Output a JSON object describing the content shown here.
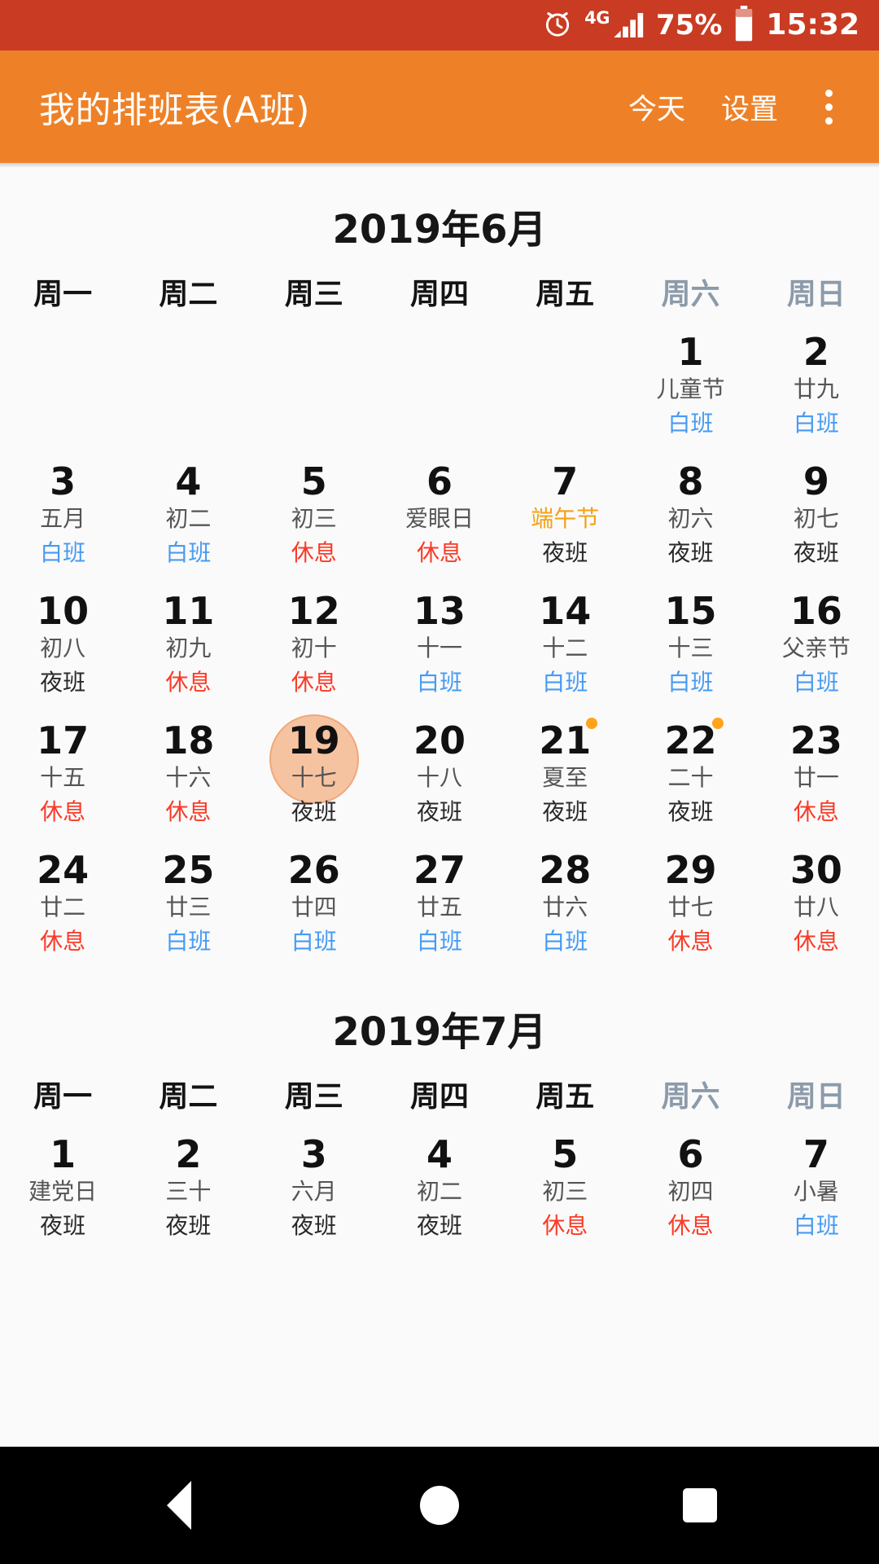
{
  "status_bar": {
    "alarm_icon": "alarm-clock-icon",
    "network_label": "4G",
    "signal_icon": "signal-bars-icon",
    "battery_percent": "75%",
    "battery_icon": "battery-icon",
    "clock": "15:32"
  },
  "toolbar": {
    "title": "我的排班表(A班)",
    "today_label": "今天",
    "settings_label": "设置",
    "overflow_icon": "overflow-menu-icon"
  },
  "colors": {
    "status_bar_bg": "#C93B22",
    "toolbar_bg": "#EE8127",
    "page_bg": "#FAFAFA",
    "weekend_header": "#8C9BAA",
    "shift_day": "#479BF3",
    "shift_night": "#282828",
    "shift_rest": "#F93B28",
    "festival_orange": "#F5A012",
    "today_circle": "#F6C3A0",
    "event_dot": "#FFA41B"
  },
  "weekdays": [
    {
      "label": "周一",
      "weekend": false
    },
    {
      "label": "周二",
      "weekend": false
    },
    {
      "label": "周三",
      "weekend": false
    },
    {
      "label": "周四",
      "weekend": false
    },
    {
      "label": "周五",
      "weekend": false
    },
    {
      "label": "周六",
      "weekend": true
    },
    {
      "label": "周日",
      "weekend": true
    }
  ],
  "months": [
    {
      "title": "2019年6月",
      "weeks": [
        [
          {
            "empty": true
          },
          {
            "empty": true
          },
          {
            "empty": true
          },
          {
            "empty": true
          },
          {
            "empty": true
          },
          {
            "day": "1",
            "lunar": "儿童节",
            "shift": "白班",
            "shift_type": "day"
          },
          {
            "day": "2",
            "lunar": "廿九",
            "shift": "白班",
            "shift_type": "day"
          }
        ],
        [
          {
            "day": "3",
            "lunar": "五月",
            "shift": "白班",
            "shift_type": "day"
          },
          {
            "day": "4",
            "lunar": "初二",
            "shift": "白班",
            "shift_type": "day"
          },
          {
            "day": "5",
            "lunar": "初三",
            "shift": "休息",
            "shift_type": "rest"
          },
          {
            "day": "6",
            "lunar": "爱眼日",
            "shift": "休息",
            "shift_type": "rest"
          },
          {
            "day": "7",
            "lunar": "端午节",
            "lunar_festival": true,
            "shift": "夜班",
            "shift_type": "night"
          },
          {
            "day": "8",
            "lunar": "初六",
            "shift": "夜班",
            "shift_type": "night"
          },
          {
            "day": "9",
            "lunar": "初七",
            "shift": "夜班",
            "shift_type": "night"
          }
        ],
        [
          {
            "day": "10",
            "lunar": "初八",
            "shift": "夜班",
            "shift_type": "night"
          },
          {
            "day": "11",
            "lunar": "初九",
            "shift": "休息",
            "shift_type": "rest"
          },
          {
            "day": "12",
            "lunar": "初十",
            "shift": "休息",
            "shift_type": "rest"
          },
          {
            "day": "13",
            "lunar": "十一",
            "shift": "白班",
            "shift_type": "day"
          },
          {
            "day": "14",
            "lunar": "十二",
            "shift": "白班",
            "shift_type": "day"
          },
          {
            "day": "15",
            "lunar": "十三",
            "shift": "白班",
            "shift_type": "day"
          },
          {
            "day": "16",
            "lunar": "父亲节",
            "shift": "白班",
            "shift_type": "day"
          }
        ],
        [
          {
            "day": "17",
            "lunar": "十五",
            "shift": "休息",
            "shift_type": "rest"
          },
          {
            "day": "18",
            "lunar": "十六",
            "shift": "休息",
            "shift_type": "rest"
          },
          {
            "day": "19",
            "lunar": "十七",
            "shift": "夜班",
            "shift_type": "night",
            "today": true
          },
          {
            "day": "20",
            "lunar": "十八",
            "shift": "夜班",
            "shift_type": "night"
          },
          {
            "day": "21",
            "lunar": "夏至",
            "shift": "夜班",
            "shift_type": "night",
            "dot": true
          },
          {
            "day": "22",
            "lunar": "二十",
            "shift": "夜班",
            "shift_type": "night",
            "dot": true
          },
          {
            "day": "23",
            "lunar": "廿一",
            "shift": "休息",
            "shift_type": "rest"
          }
        ],
        [
          {
            "day": "24",
            "lunar": "廿二",
            "shift": "休息",
            "shift_type": "rest"
          },
          {
            "day": "25",
            "lunar": "廿三",
            "shift": "白班",
            "shift_type": "day"
          },
          {
            "day": "26",
            "lunar": "廿四",
            "shift": "白班",
            "shift_type": "day"
          },
          {
            "day": "27",
            "lunar": "廿五",
            "shift": "白班",
            "shift_type": "day"
          },
          {
            "day": "28",
            "lunar": "廿六",
            "shift": "白班",
            "shift_type": "day"
          },
          {
            "day": "29",
            "lunar": "廿七",
            "shift": "休息",
            "shift_type": "rest"
          },
          {
            "day": "30",
            "lunar": "廿八",
            "shift": "休息",
            "shift_type": "rest"
          }
        ]
      ]
    },
    {
      "title": "2019年7月",
      "weeks": [
        [
          {
            "day": "1",
            "lunar": "建党日",
            "shift": "夜班",
            "shift_type": "night"
          },
          {
            "day": "2",
            "lunar": "三十",
            "shift": "夜班",
            "shift_type": "night"
          },
          {
            "day": "3",
            "lunar": "六月",
            "shift": "夜班",
            "shift_type": "night"
          },
          {
            "day": "4",
            "lunar": "初二",
            "shift": "夜班",
            "shift_type": "night"
          },
          {
            "day": "5",
            "lunar": "初三",
            "shift": "休息",
            "shift_type": "rest"
          },
          {
            "day": "6",
            "lunar": "初四",
            "shift": "休息",
            "shift_type": "rest"
          },
          {
            "day": "7",
            "lunar": "小暑",
            "shift": "白班",
            "shift_type": "day"
          }
        ]
      ]
    }
  ],
  "nav_bar": {
    "back_icon": "back-triangle-icon",
    "home_icon": "home-circle-icon",
    "recents_icon": "recents-square-icon"
  }
}
